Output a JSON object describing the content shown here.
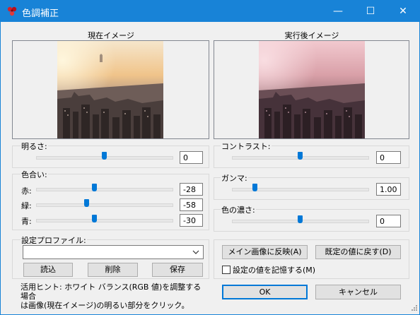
{
  "window": {
    "title": "色調補正",
    "minimize_glyph": "—",
    "maximize_glyph": "☐",
    "close_glyph": "✕"
  },
  "preview": {
    "current_label": "現在イメージ",
    "result_label": "実行後イメージ"
  },
  "brightness": {
    "label": "明るさ:",
    "value": "0",
    "level": 0.5
  },
  "hue": {
    "label": "色合い:",
    "rows": [
      {
        "label": "赤:",
        "value": "-28",
        "level": 0.43
      },
      {
        "label": "緑:",
        "value": "-58",
        "level": 0.37
      },
      {
        "label": "青:",
        "value": "-30",
        "level": 0.43
      }
    ]
  },
  "contrast": {
    "label": "コントラスト:",
    "value": "0",
    "level": 0.5
  },
  "gamma": {
    "label": "ガンマ:",
    "value": "1.00",
    "level": 0.17
  },
  "saturation": {
    "label": "色の濃さ:",
    "value": "0",
    "level": 0.5
  },
  "profile": {
    "label": "設定プロファイル:",
    "selected": "",
    "load_label": "読込",
    "delete_label": "削除",
    "save_label": "保存"
  },
  "actions": {
    "apply_main_label": "メイン画像に反映(A)",
    "reset_label": "既定の値に戻す(D)",
    "remember_label": "設定の値を記憶する(M)",
    "remember_checked": false,
    "ok_label": "OK",
    "cancel_label": "キャンセル"
  },
  "hint": {
    "line1": "活用ヒント: ホワイト バランス(RGB 値)を調整する場合",
    "line2": "は画像(現在イメージ)の明るい部分をクリック。"
  },
  "colors": {
    "titlebar": "#1883d7",
    "accent": "#0078d7"
  }
}
